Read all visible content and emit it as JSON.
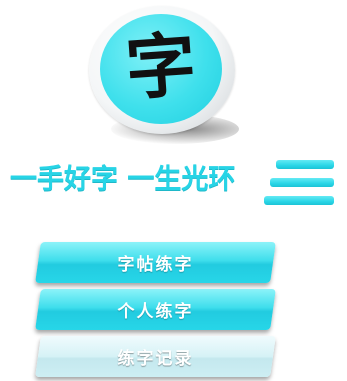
{
  "logo": {
    "character": "字"
  },
  "slogan": "一手好字 一生光环",
  "menu": [
    {
      "label": "字帖练字",
      "state": "active"
    },
    {
      "label": "个人练字",
      "state": "active"
    },
    {
      "label": "练字记录",
      "state": "disabled"
    }
  ],
  "colors": {
    "accent": "#27d4e6",
    "button_active": "#3fdeec",
    "button_disabled": "#d6f2f6"
  }
}
